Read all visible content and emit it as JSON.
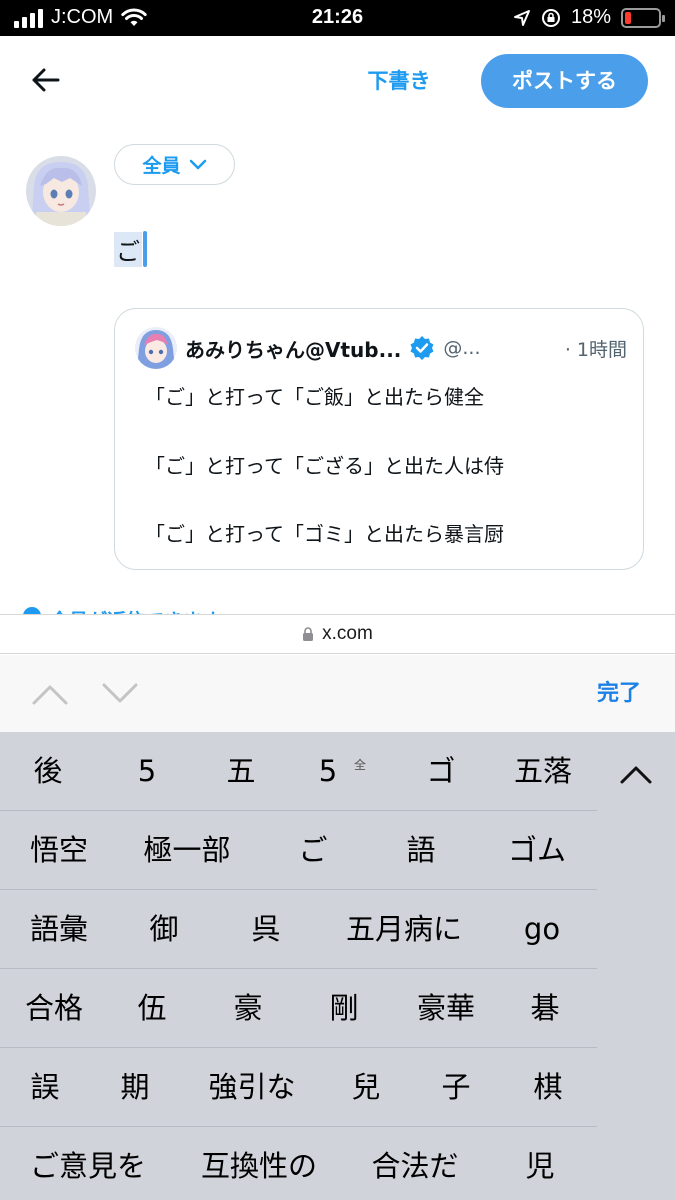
{
  "status_bar": {
    "carrier": "J:COM",
    "time": "21:26",
    "battery_percent": "18%",
    "battery_level": 0.18,
    "battery_color": "#ff3b30"
  },
  "compose": {
    "draft_label": "下書き",
    "post_label": "ポストする",
    "audience_label": "全員",
    "typed_text": "ご",
    "reply_permission_text": "全員が返信できます"
  },
  "quote": {
    "name": "あみりちゃん@Vtub...",
    "handle": "@...",
    "time": "· 1時間",
    "lines": [
      "「ご」と打って「ご飯」と出たら健全",
      "「ご」と打って「ござる」と出た人は侍",
      "「ご」と打って「ゴミ」と出たら暴言厨"
    ]
  },
  "browser": {
    "url": "x.com"
  },
  "keyboard": {
    "done_label": "完了",
    "candidate_rows": [
      [
        "後",
        "5",
        "五",
        "5",
        "ゴ",
        "五落"
      ],
      [
        "悟空",
        "極一部",
        "ご",
        "語",
        "ゴム"
      ],
      [
        "語彙",
        "御",
        "呉",
        "五月病に",
        "go"
      ],
      [
        "合格",
        "伍",
        "豪",
        "剛",
        "豪華",
        "碁"
      ],
      [
        "誤",
        "期",
        "強引な",
        "兒",
        "子",
        "棋"
      ],
      [
        "ご意見を",
        "互換性の",
        "合法だ",
        "児"
      ]
    ],
    "fullwidth_note": "全"
  },
  "colors": {
    "accent": "#1d9bf0",
    "post_button": "#4b9fea",
    "keyboard_bg": "#d0d3da"
  }
}
